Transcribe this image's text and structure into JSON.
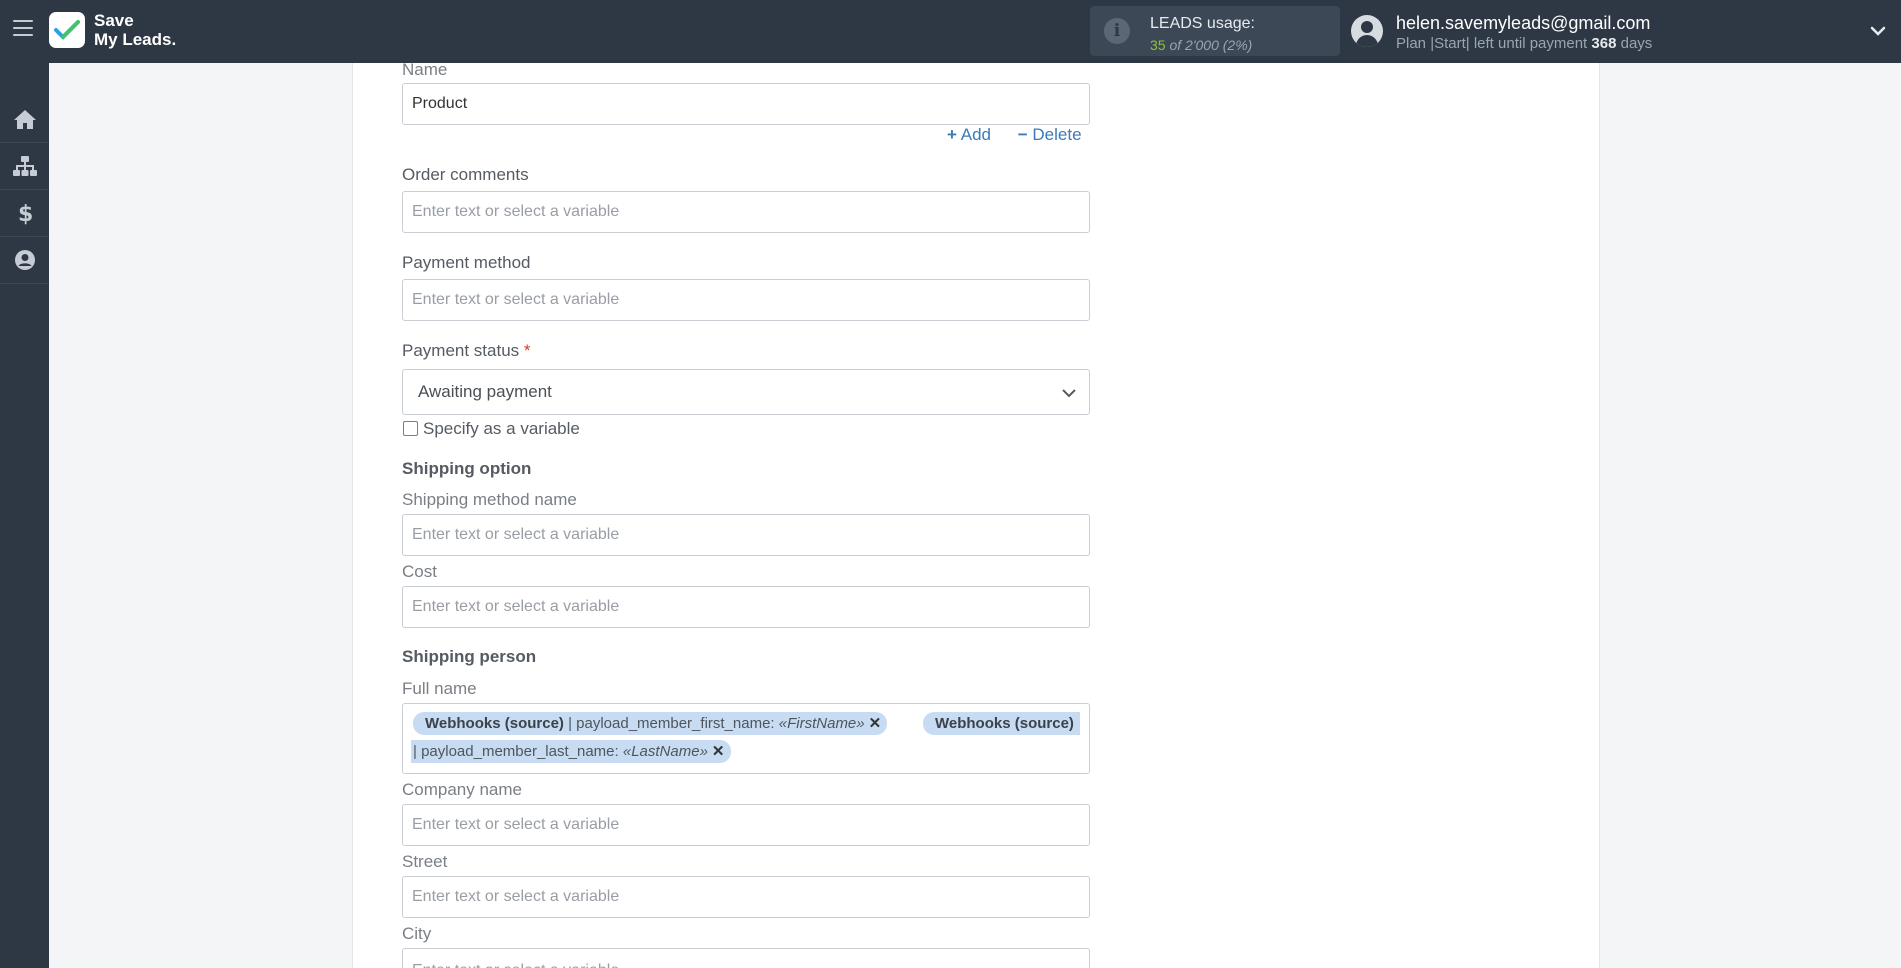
{
  "app": {
    "logo_line1": "Save",
    "logo_line2": "My Leads."
  },
  "usage": {
    "title": "LEADS usage:",
    "used": "35",
    "of_label": "of 2'000",
    "percent": "(2%)"
  },
  "account": {
    "email": "helen.savemyleads@gmail.com",
    "plan_prefix": "Plan |Start| left until payment",
    "days": "368",
    "days_suffix": "days"
  },
  "sidebar": {
    "items": [
      "home-icon",
      "sitemap-icon",
      "dollar-icon",
      "user-circle-icon"
    ]
  },
  "form": {
    "name_label": "Name",
    "name_value": "Product",
    "add_label": "Add",
    "delete_label": "Delete",
    "order_comments_label": "Order comments",
    "payment_method_label": "Payment method",
    "payment_status_label": "Payment status",
    "required_mark": "*",
    "payment_status_value": "Awaiting payment",
    "specify_variable_label": "Specify as a variable",
    "shipping_option_label": "Shipping option",
    "shipping_method_name_label": "Shipping method name",
    "cost_label": "Cost",
    "shipping_person_label": "Shipping person",
    "full_name_label": "Full name",
    "company_name_label": "Company name",
    "street_label": "Street",
    "city_label": "City",
    "placeholder": "Enter text or select a variable",
    "tags": [
      {
        "source": "Webhooks (source)",
        "field": "| payload_member_first_name:",
        "value": "«FirstName»"
      },
      {
        "source": "Webhooks (source)",
        "field": "| payload_member_last_name:",
        "value": "«LastName»"
      }
    ]
  }
}
